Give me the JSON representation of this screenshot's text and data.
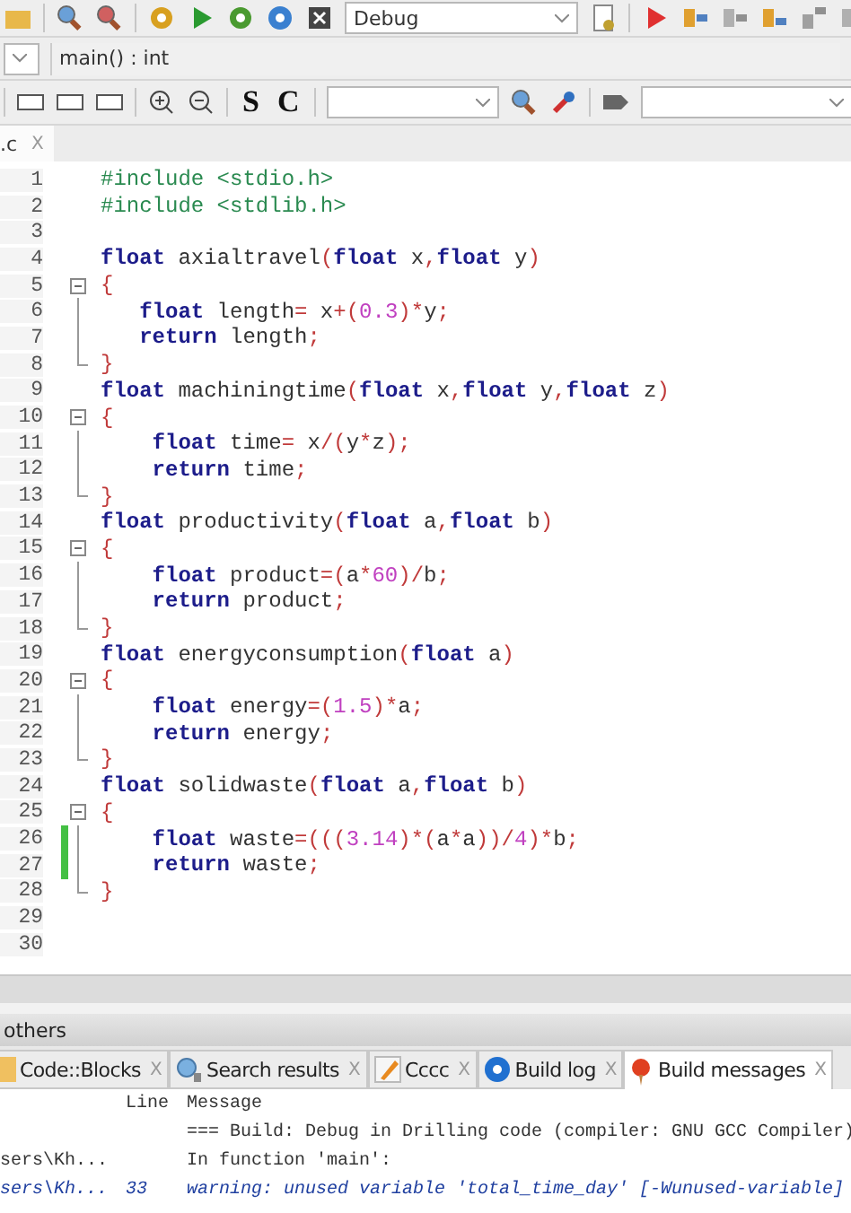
{
  "toolbar": {
    "build_target": "Debug"
  },
  "function_bar": {
    "scope": "main() : int"
  },
  "format_toolbar": {
    "buttons": [
      "S",
      "C"
    ]
  },
  "editor": {
    "tab": {
      "label": ".c",
      "close": "X"
    },
    "lines": [
      {
        "number": "1",
        "kind": "code",
        "changed": false,
        "tokens": [
          {
            "kind": "preproc",
            "text": "#include <stdio.h>"
          }
        ]
      },
      {
        "number": "2",
        "kind": "code",
        "changed": false,
        "tokens": [
          {
            "kind": "preproc",
            "text": "#include <stdlib.h>"
          }
        ]
      },
      {
        "number": "3",
        "kind": "code",
        "changed": false
      },
      {
        "number": "4",
        "kind": "code",
        "changed": false,
        "tokens": [
          {
            "kind": "keyword",
            "text": "float"
          },
          {
            "kind": "ident",
            "text": " axialtravel"
          },
          {
            "kind": "punct",
            "text": "("
          },
          {
            "kind": "keyword",
            "text": "float"
          },
          {
            "kind": "ident",
            "text": " x"
          },
          {
            "kind": "punct",
            "text": ","
          },
          {
            "kind": "keyword",
            "text": "float"
          },
          {
            "kind": "ident",
            "text": " y"
          },
          {
            "kind": "punct",
            "text": ")"
          }
        ]
      },
      {
        "number": "5",
        "kind": "fold_start",
        "changed": false,
        "tokens": [
          {
            "kind": "punct",
            "text": "{"
          }
        ]
      },
      {
        "number": "6",
        "kind": "block",
        "changed": false,
        "tokens": [
          {
            "kind": "keyword",
            "text": "   float"
          },
          {
            "kind": "ident",
            "text": " length"
          },
          {
            "kind": "punct",
            "text": "="
          },
          {
            "kind": "ident",
            "text": " x"
          },
          {
            "kind": "punct",
            "text": "+("
          },
          {
            "kind": "number",
            "text": "0.3"
          },
          {
            "kind": "punct",
            "text": ")*"
          },
          {
            "kind": "ident",
            "text": "y"
          },
          {
            "kind": "punct",
            "text": ";"
          }
        ]
      },
      {
        "number": "7",
        "kind": "block",
        "changed": false,
        "tokens": [
          {
            "kind": "keyword",
            "text": "   return"
          },
          {
            "kind": "ident",
            "text": " length"
          },
          {
            "kind": "punct",
            "text": ";"
          }
        ]
      },
      {
        "number": "8",
        "kind": "block_end",
        "changed": false,
        "tokens": [
          {
            "kind": "punct",
            "text": "}"
          }
        ]
      },
      {
        "number": "9",
        "kind": "code",
        "changed": false,
        "tokens": [
          {
            "kind": "keyword",
            "text": "float"
          },
          {
            "kind": "ident",
            "text": " machiningtime"
          },
          {
            "kind": "punct",
            "text": "("
          },
          {
            "kind": "keyword",
            "text": "float"
          },
          {
            "kind": "ident",
            "text": " x"
          },
          {
            "kind": "punct",
            "text": ","
          },
          {
            "kind": "keyword",
            "text": "float"
          },
          {
            "kind": "ident",
            "text": " y"
          },
          {
            "kind": "punct",
            "text": ","
          },
          {
            "kind": "keyword",
            "text": "float"
          },
          {
            "kind": "ident",
            "text": " z"
          },
          {
            "kind": "punct",
            "text": ")"
          }
        ]
      },
      {
        "number": "10",
        "kind": "fold_start",
        "changed": false,
        "tokens": [
          {
            "kind": "punct",
            "text": "{"
          }
        ]
      },
      {
        "number": "11",
        "kind": "block",
        "changed": false,
        "tokens": [
          {
            "kind": "keyword",
            "text": "    float"
          },
          {
            "kind": "ident",
            "text": " time"
          },
          {
            "kind": "punct",
            "text": "="
          },
          {
            "kind": "ident",
            "text": " x"
          },
          {
            "kind": "punct",
            "text": "/("
          },
          {
            "kind": "ident",
            "text": "y"
          },
          {
            "kind": "punct",
            "text": "*"
          },
          {
            "kind": "ident",
            "text": "z"
          },
          {
            "kind": "punct",
            "text": ");"
          }
        ]
      },
      {
        "number": "12",
        "kind": "block",
        "changed": false,
        "tokens": [
          {
            "kind": "keyword",
            "text": "    return"
          },
          {
            "kind": "ident",
            "text": " time"
          },
          {
            "kind": "punct",
            "text": ";"
          }
        ]
      },
      {
        "number": "13",
        "kind": "block_end",
        "changed": false,
        "tokens": [
          {
            "kind": "punct",
            "text": "}"
          }
        ]
      },
      {
        "number": "14",
        "kind": "code",
        "changed": false,
        "tokens": [
          {
            "kind": "keyword",
            "text": "float"
          },
          {
            "kind": "ident",
            "text": " productivity"
          },
          {
            "kind": "punct",
            "text": "("
          },
          {
            "kind": "keyword",
            "text": "float"
          },
          {
            "kind": "ident",
            "text": " a"
          },
          {
            "kind": "punct",
            "text": ","
          },
          {
            "kind": "keyword",
            "text": "float"
          },
          {
            "kind": "ident",
            "text": " b"
          },
          {
            "kind": "punct",
            "text": ")"
          }
        ]
      },
      {
        "number": "15",
        "kind": "fold_start",
        "changed": false,
        "tokens": [
          {
            "kind": "punct",
            "text": "{"
          }
        ]
      },
      {
        "number": "16",
        "kind": "block",
        "changed": false,
        "tokens": [
          {
            "kind": "keyword",
            "text": "    float"
          },
          {
            "kind": "ident",
            "text": " product"
          },
          {
            "kind": "punct",
            "text": "=("
          },
          {
            "kind": "ident",
            "text": "a"
          },
          {
            "kind": "punct",
            "text": "*"
          },
          {
            "kind": "number",
            "text": "60"
          },
          {
            "kind": "punct",
            "text": ")/"
          },
          {
            "kind": "ident",
            "text": "b"
          },
          {
            "kind": "punct",
            "text": ";"
          }
        ]
      },
      {
        "number": "17",
        "kind": "block",
        "changed": false,
        "tokens": [
          {
            "kind": "keyword",
            "text": "    return"
          },
          {
            "kind": "ident",
            "text": " product"
          },
          {
            "kind": "punct",
            "text": ";"
          }
        ]
      },
      {
        "number": "18",
        "kind": "block_end",
        "changed": false,
        "tokens": [
          {
            "kind": "punct",
            "text": "}"
          }
        ]
      },
      {
        "number": "19",
        "kind": "code",
        "changed": false,
        "tokens": [
          {
            "kind": "keyword",
            "text": "float"
          },
          {
            "kind": "ident",
            "text": " energyconsumption"
          },
          {
            "kind": "punct",
            "text": "("
          },
          {
            "kind": "keyword",
            "text": "float"
          },
          {
            "kind": "ident",
            "text": " a"
          },
          {
            "kind": "punct",
            "text": ")"
          }
        ]
      },
      {
        "number": "20",
        "kind": "fold_start",
        "changed": false,
        "tokens": [
          {
            "kind": "punct",
            "text": "{"
          }
        ]
      },
      {
        "number": "21",
        "kind": "block",
        "changed": false,
        "tokens": [
          {
            "kind": "keyword",
            "text": "    float"
          },
          {
            "kind": "ident",
            "text": " energy"
          },
          {
            "kind": "punct",
            "text": "=("
          },
          {
            "kind": "number",
            "text": "1.5"
          },
          {
            "kind": "punct",
            "text": ")*"
          },
          {
            "kind": "ident",
            "text": "a"
          },
          {
            "kind": "punct",
            "text": ";"
          }
        ]
      },
      {
        "number": "22",
        "kind": "block",
        "changed": false,
        "tokens": [
          {
            "kind": "keyword",
            "text": "    return"
          },
          {
            "kind": "ident",
            "text": " energy"
          },
          {
            "kind": "punct",
            "text": ";"
          }
        ]
      },
      {
        "number": "23",
        "kind": "block_end",
        "changed": false,
        "tokens": [
          {
            "kind": "punct",
            "text": "}"
          }
        ]
      },
      {
        "number": "24",
        "kind": "code",
        "changed": false,
        "tokens": [
          {
            "kind": "keyword",
            "text": "float"
          },
          {
            "kind": "ident",
            "text": " solidwaste"
          },
          {
            "kind": "punct",
            "text": "("
          },
          {
            "kind": "keyword",
            "text": "float"
          },
          {
            "kind": "ident",
            "text": " a"
          },
          {
            "kind": "punct",
            "text": ","
          },
          {
            "kind": "keyword",
            "text": "float"
          },
          {
            "kind": "ident",
            "text": " b"
          },
          {
            "kind": "punct",
            "text": ")"
          }
        ]
      },
      {
        "number": "25",
        "kind": "fold_start",
        "changed": false,
        "tokens": [
          {
            "kind": "punct",
            "text": "{"
          }
        ]
      },
      {
        "number": "26",
        "kind": "block",
        "changed": true,
        "tokens": [
          {
            "kind": "keyword",
            "text": "    float"
          },
          {
            "kind": "ident",
            "text": " waste"
          },
          {
            "kind": "punct",
            "text": "=((("
          },
          {
            "kind": "number",
            "text": "3.14"
          },
          {
            "kind": "punct",
            "text": ")*("
          },
          {
            "kind": "ident",
            "text": "a"
          },
          {
            "kind": "punct",
            "text": "*"
          },
          {
            "kind": "ident",
            "text": "a"
          },
          {
            "kind": "punct",
            "text": "))/"
          },
          {
            "kind": "number",
            "text": "4"
          },
          {
            "kind": "punct",
            "text": ")*"
          },
          {
            "kind": "ident",
            "text": "b"
          },
          {
            "kind": "punct",
            "text": ";"
          }
        ]
      },
      {
        "number": "27",
        "kind": "block",
        "changed": true,
        "tokens": [
          {
            "kind": "keyword",
            "text": "    return"
          },
          {
            "kind": "ident",
            "text": " waste"
          },
          {
            "kind": "punct",
            "text": ";"
          }
        ]
      },
      {
        "number": "28",
        "kind": "block_end",
        "changed": false,
        "tokens": [
          {
            "kind": "punct",
            "text": "}"
          }
        ]
      },
      {
        "number": "29",
        "kind": "code",
        "changed": false
      },
      {
        "number": "30",
        "kind": "code",
        "changed": false
      }
    ]
  },
  "logs_panel": {
    "title": "others",
    "tabs": [
      {
        "label": "Code::Blocks",
        "close": "X",
        "selected": false
      },
      {
        "label": "Search results",
        "close": "X",
        "selected": false
      },
      {
        "label": "Cccc",
        "close": "X",
        "selected": false
      },
      {
        "label": "Build log",
        "close": "X",
        "selected": false
      },
      {
        "label": "Build messages",
        "close": "X",
        "selected": true
      }
    ],
    "columns": [
      "Line",
      "Message"
    ],
    "rows": [
      {
        "kind": "info",
        "file": "",
        "line": "",
        "message": "=== Build: Debug in Drilling code (compiler: GNU GCC Compiler)"
      },
      {
        "kind": "info",
        "file": "sers\\Kh...",
        "line": "",
        "message": "In function 'main':"
      },
      {
        "kind": "warning",
        "file": "sers\\Kh...",
        "line": "33",
        "message": "warning: unused variable 'total_time_day' [-Wunused-variable]"
      }
    ]
  }
}
